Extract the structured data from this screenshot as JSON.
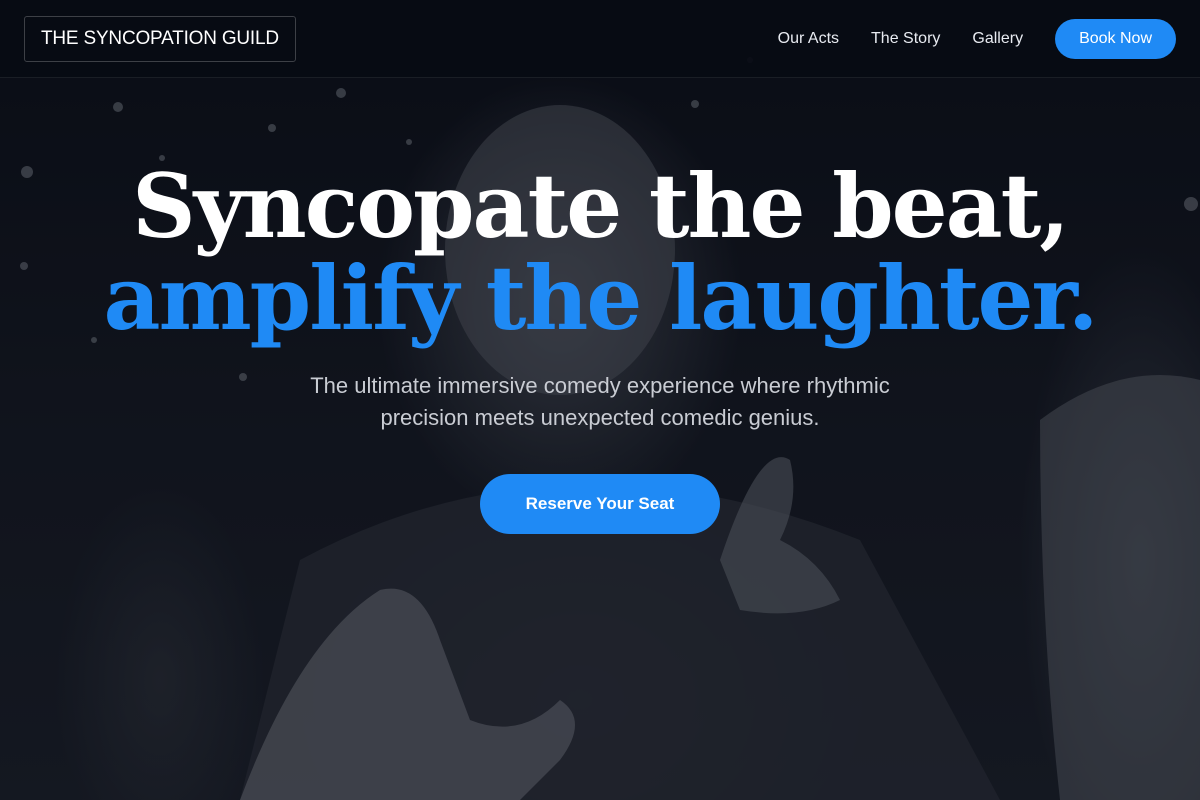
{
  "header": {
    "brand": "THE SYNCOPATION GUILD",
    "nav": [
      {
        "label": "Our Acts"
      },
      {
        "label": "The Story"
      },
      {
        "label": "Gallery"
      }
    ],
    "cta_label": "Book Now"
  },
  "hero": {
    "headline_line1": "Syncopate the beat,",
    "headline_line2": "amplify the laughter.",
    "subtitle": "The ultimate immersive comedy experience where rhythmic precision meets unexpected comedic genius.",
    "cta_label": "Reserve Your Seat",
    "background_image": "comedian-pointing-photo"
  },
  "colors": {
    "accent": "#1f8af5",
    "background": "#080b14",
    "text": "#ffffff",
    "muted_text": "#c9ccd3"
  }
}
